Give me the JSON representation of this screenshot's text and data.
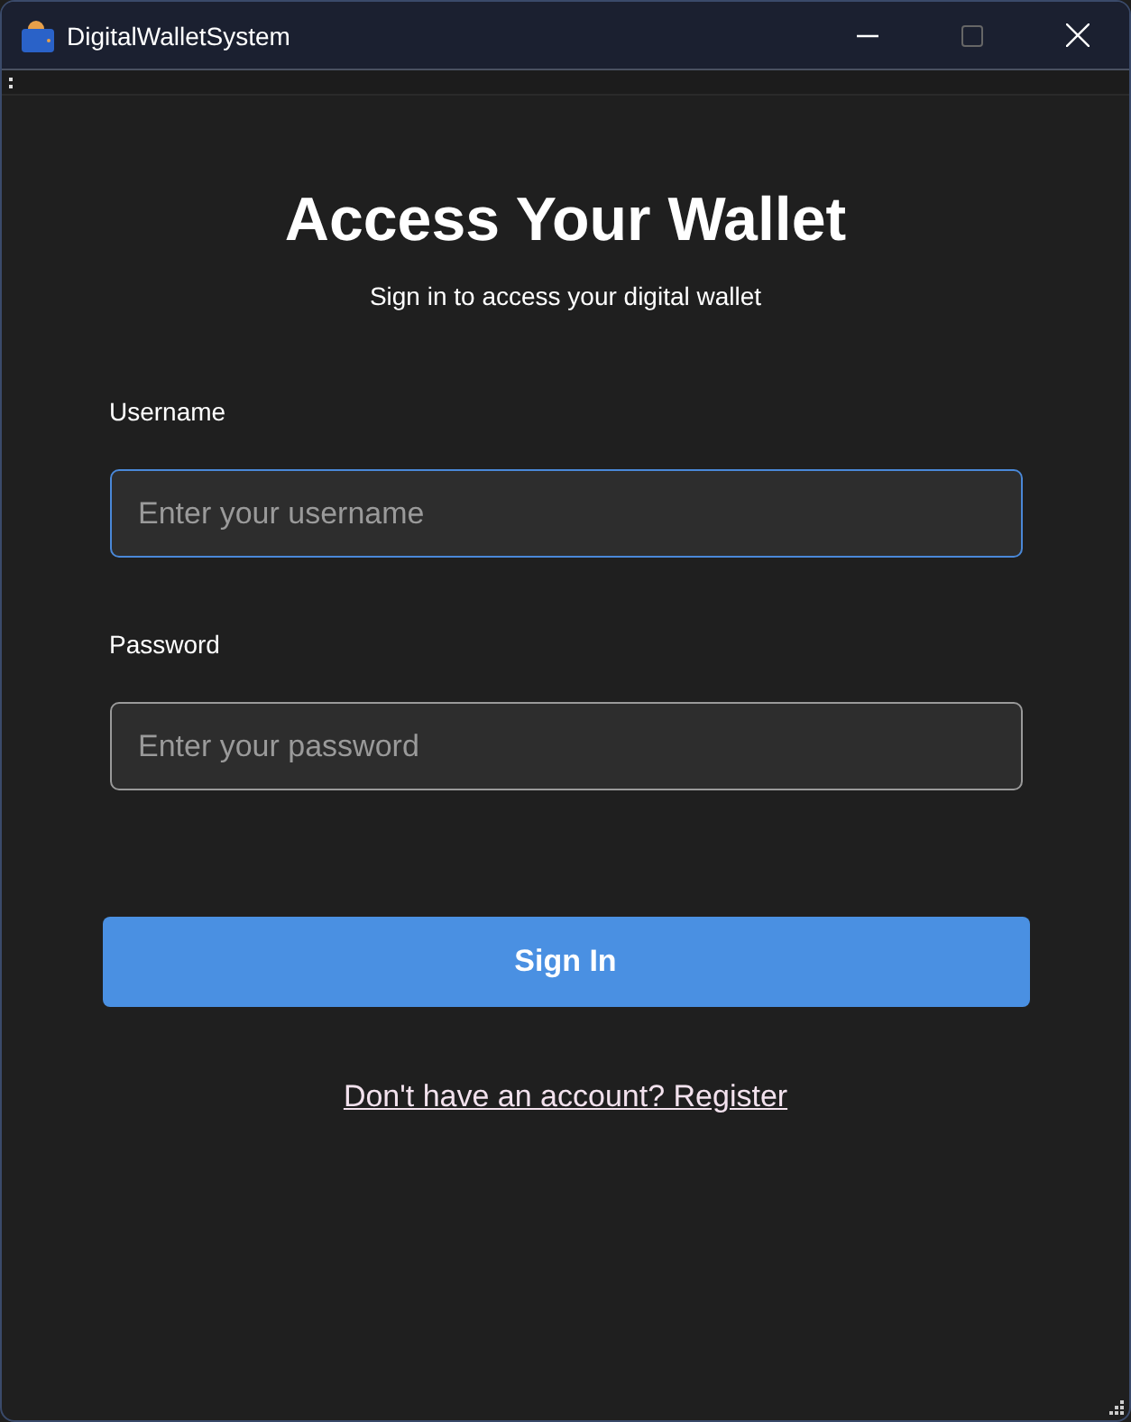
{
  "window": {
    "title": "DigitalWalletSystem"
  },
  "heading": "Access Your Wallet",
  "subheading": "Sign in to access your digital wallet",
  "fields": [
    {
      "label": "Username",
      "placeholder": "Enter your username",
      "focused": true
    },
    {
      "label": "Password",
      "placeholder": "Enter your password",
      "focused": false
    }
  ],
  "sign_in_button": "Sign In",
  "register_link": "Don't have an account? Register"
}
